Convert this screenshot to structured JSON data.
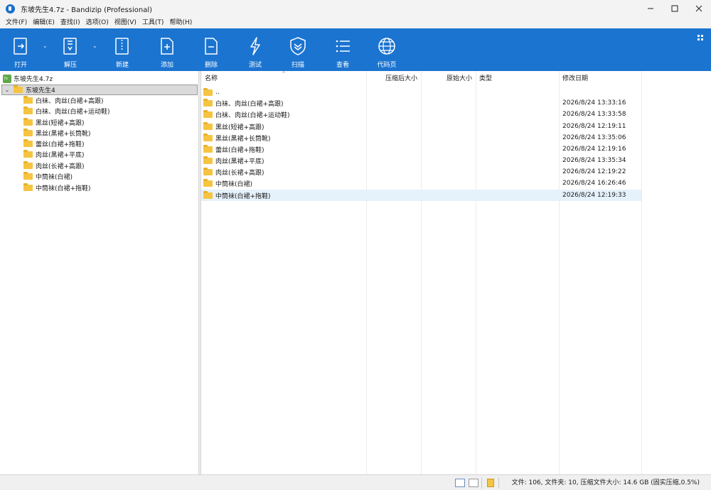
{
  "window": {
    "title": "东坡先生4.7z - Bandizip (Professional)",
    "minimize": "—",
    "close": "✕"
  },
  "menu": [
    "文件(F)",
    "编辑(E)",
    "查找(I)",
    "选项(O)",
    "视图(V)",
    "工具(T)",
    "帮助(H)"
  ],
  "toolbar": {
    "open": "打开",
    "extract": "解压",
    "new": "新建",
    "add": "添加",
    "delete": "删除",
    "test": "测试",
    "scan": "扫描",
    "view": "查看",
    "codepage": "代码页",
    "dropdown_glyph": "⌄"
  },
  "tree": {
    "root": "东坡先生4.7z",
    "selected": "东坡先生4",
    "expand_glyph": "⌄",
    "children": [
      "白袜、肉丝(白裙+高跟)",
      "白袜、肉丝(白裙+运动鞋)",
      "黑丝(短裙+高跟)",
      "黑丝(黑裙+长筒靴)",
      "蕾丝(白裙+拖鞋)",
      "肉丝(黑裙+平底)",
      "肉丝(长裙+高跟)",
      "中筒袜(白裙)",
      "中筒袜(白裙+拖鞋)"
    ]
  },
  "list": {
    "columns": {
      "name": "名称",
      "packed": "压缩后大小",
      "original": "原始大小",
      "type": "类型",
      "modified": "修改日期"
    },
    "sort_glyph": "^",
    "parent_row": "..",
    "rows": [
      {
        "name": "白袜、肉丝(白裙+高跟)",
        "modified": "2026/8/24 13:33:16"
      },
      {
        "name": "白袜、肉丝(白裙+运动鞋)",
        "modified": "2026/8/24 13:33:58"
      },
      {
        "name": "黑丝(短裙+高跟)",
        "modified": "2026/8/24 12:19:11"
      },
      {
        "name": "黑丝(黑裙+长筒靴)",
        "modified": "2026/8/24 13:35:06"
      },
      {
        "name": "蕾丝(白裙+拖鞋)",
        "modified": "2026/8/24 12:19:16"
      },
      {
        "name": "肉丝(黑裙+平底)",
        "modified": "2026/8/24 13:35:34"
      },
      {
        "name": "肉丝(长裙+高跟)",
        "modified": "2026/8/24 12:19:22"
      },
      {
        "name": "中筒袜(白裙)",
        "modified": "2026/8/24 16:26:46"
      },
      {
        "name": "中筒袜(白裙+拖鞋)",
        "modified": "2026/8/24 12:19:33"
      }
    ]
  },
  "status": {
    "summary": "文件: 106, 文件夹: 10, 压缩文件大小: 14.6 GB (固实压缩,0.5%)"
  }
}
